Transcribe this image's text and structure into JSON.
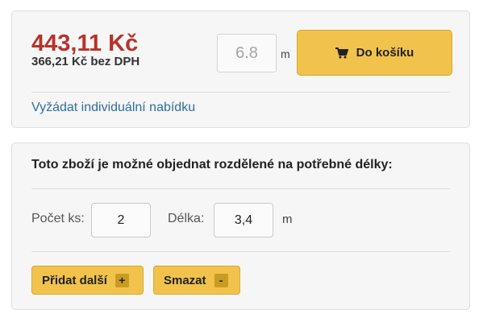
{
  "price_panel": {
    "price": "443,11 Kč",
    "price_without_vat": "366,21 Kč bez DPH",
    "quantity_value": "6.8",
    "quantity_unit": "m",
    "cart_button_label": "Do košíku",
    "cart_icon": "shopping-cart-icon",
    "request_link": "Vyžádat individuální nabídku"
  },
  "split_panel": {
    "title": "Toto zboží je možné objednat rozdělené na potřebné délky:",
    "count_label": "Počet ks:",
    "count_value": "2",
    "length_label": "Délka:",
    "length_value": "3,4",
    "length_unit": "m",
    "add_button_label": "Přidat další",
    "add_button_sign": "+",
    "delete_button_label": "Smazat",
    "delete_button_sign": "-"
  },
  "colors": {
    "price": "#b8322a",
    "button": "#f1c34c",
    "link": "#2c6ea2",
    "panel_background": "#f6f6f6"
  }
}
